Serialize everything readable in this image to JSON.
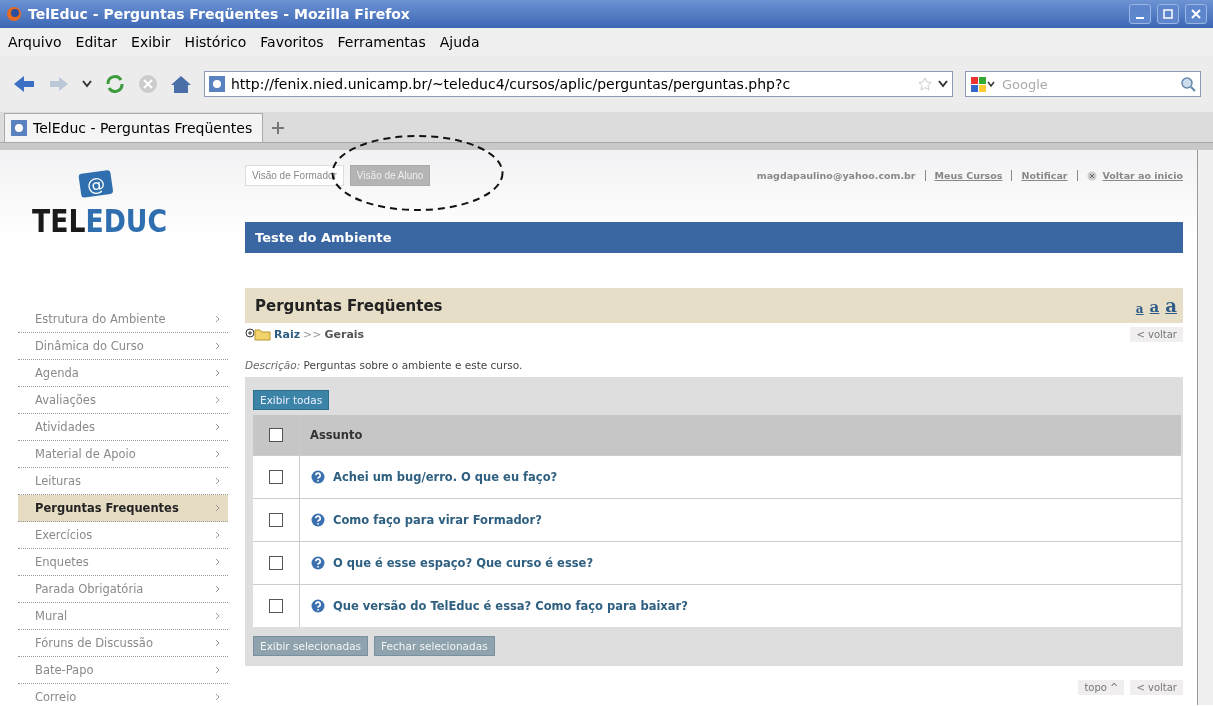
{
  "window": {
    "title": "TelEduc - Perguntas Freqüentes - Mozilla Firefox"
  },
  "menu": [
    "Arquivo",
    "Editar",
    "Exibir",
    "Histórico",
    "Favoritos",
    "Ferramentas",
    "Ajuda"
  ],
  "address": {
    "value": "http://fenix.nied.unicamp.br/~teleduc4/cursos/aplic/perguntas/perguntas.php?c"
  },
  "search": {
    "placeholder": "Google"
  },
  "tabs": [
    {
      "label": "TelEduc - Perguntas Freqüentes",
      "selected": true
    }
  ],
  "logo": {
    "symbol": "@",
    "text_dark": "TEL",
    "text_blue": "EDUC"
  },
  "views": [
    {
      "label": "Visão de Formador",
      "selected": false
    },
    {
      "label": "Visão de Aluno",
      "selected": true
    }
  ],
  "user_links": [
    {
      "label": "magdapaulino@yahoo.com.br",
      "kind": "text"
    },
    {
      "label": "Meus Cursos",
      "kind": "link"
    },
    {
      "label": "Notificar",
      "kind": "link"
    },
    {
      "label": "Voltar ao inicio",
      "kind": "close-link"
    }
  ],
  "course_title": "Teste do Ambiente",
  "sidebar": {
    "items": [
      {
        "label": "Estrutura do Ambiente",
        "selected": false
      },
      {
        "label": "Dinâmica do Curso",
        "selected": false
      },
      {
        "label": "Agenda",
        "selected": false
      },
      {
        "label": "Avaliações",
        "selected": false
      },
      {
        "label": "Atividades",
        "selected": false
      },
      {
        "label": "Material de Apoio",
        "selected": false
      },
      {
        "label": "Leituras",
        "selected": false
      },
      {
        "label": "Perguntas Frequentes",
        "selected": true
      },
      {
        "label": "Exercícios",
        "selected": false
      },
      {
        "label": "Enquetes",
        "selected": false
      },
      {
        "label": "Parada Obrigatória",
        "selected": false
      },
      {
        "label": "Mural",
        "selected": false
      },
      {
        "label": "Fóruns de Discussão",
        "selected": false
      },
      {
        "label": "Bate-Papo",
        "selected": false
      },
      {
        "label": "Correio",
        "selected": false
      }
    ]
  },
  "section": {
    "title": "Perguntas Freqüentes",
    "font_sizes": [
      "a",
      "a",
      "a"
    ]
  },
  "breadcrumb": {
    "root": "Raiz",
    "separator": ">>",
    "current": "Gerais"
  },
  "back_link": "< voltar",
  "description": {
    "label": "Descrição:",
    "text": "Perguntas sobre o ambiente e este curso."
  },
  "show_all_button": "Exibir todas",
  "table": {
    "header_checked": false,
    "column": "Assunto",
    "rows": [
      {
        "question": "Achei um bug/erro. O que eu faço?",
        "checked": false
      },
      {
        "question": "Como faço para virar Formador?",
        "checked": false
      },
      {
        "question": "O que é esse espaço? Que curso é esse?",
        "checked": false
      },
      {
        "question": "Que versão do TelEduc é essa? Como faço para baixar?",
        "checked": false
      }
    ]
  },
  "bottom_buttons": [
    "Exibir selecionadas",
    "Fechar selecionadas"
  ],
  "footer_links": [
    "topo ^",
    "< voltar"
  ]
}
